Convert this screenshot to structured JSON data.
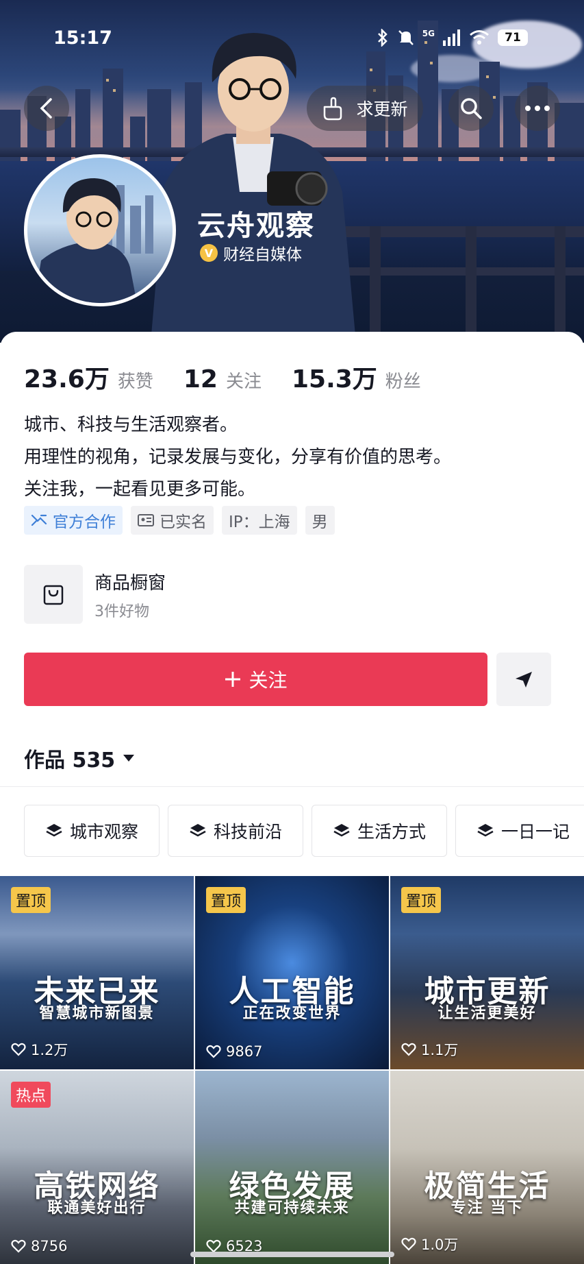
{
  "status_bar": {
    "time": "15:17",
    "network": "5G",
    "battery": "71"
  },
  "header": {
    "request_update_label": "求更新"
  },
  "profile": {
    "name": "云舟观察",
    "verify_badge": "V",
    "verified_label": "财经自媒体"
  },
  "stats": [
    {
      "value": "23.6万",
      "label": "获赞"
    },
    {
      "value": "12",
      "label": "关注"
    },
    {
      "value": "15.3万",
      "label": "粉丝"
    }
  ],
  "bio": [
    "城市、科技与生活观察者。",
    "用理性的视角，记录发展与变化，分享有价值的思考。",
    "关注我，一起看见更多可能。"
  ],
  "tags": {
    "official": "官方合作",
    "realname": "已实名",
    "ip": "IP：上海",
    "gender": "男"
  },
  "shop": {
    "title": "商品橱窗",
    "subtitle": "3件好物"
  },
  "follow_button": "关注",
  "works": {
    "label": "作品 535"
  },
  "collections": [
    "城市观察",
    "科技前沿",
    "生活方式",
    "一日一记"
  ],
  "videos": [
    {
      "badge": "置顶",
      "title": "未来已来",
      "subtitle": "智慧城市新图景",
      "likes": "1.2万"
    },
    {
      "badge": "置顶",
      "title": "人工智能",
      "subtitle": "正在改变世界",
      "likes": "9867"
    },
    {
      "badge": "置顶",
      "title": "城市更新",
      "subtitle": "让生活更美好",
      "likes": "1.1万"
    },
    {
      "badge": "热点",
      "title": "高铁网络",
      "subtitle": "联通美好出行",
      "likes": "8756"
    },
    {
      "badge": "",
      "title": "绿色发展",
      "subtitle": "共建可持续未来",
      "likes": "6523"
    },
    {
      "badge": "",
      "title": "极简生活",
      "subtitle": "专注 当下",
      "likes": "1.0万"
    }
  ],
  "colors": {
    "accent": "#ea3a55",
    "pin_badge": "#f5c64b",
    "hot_badge": "#f04a5c",
    "official_tag": "#3e7fd7"
  }
}
